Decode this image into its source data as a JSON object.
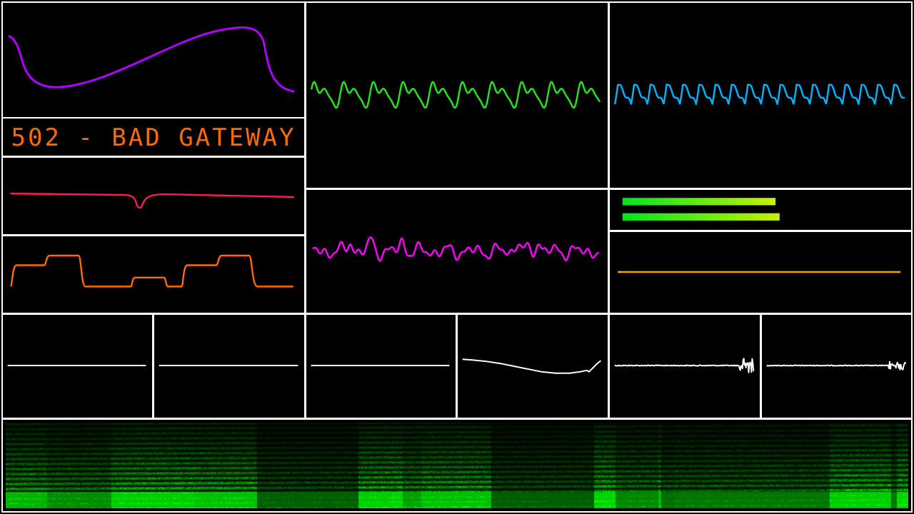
{
  "status": {
    "text": "502 - BAD GATEWAY",
    "color": "#ff6a00"
  },
  "colors": {
    "background": "#000000",
    "border": "#ffffff",
    "envelope_trace": "#b000ff",
    "dip_trace": "#ff1a5c",
    "step_trace": "#ff6a00",
    "green_wave": "#22e51a",
    "blue_wave": "#00b2ff",
    "magenta_wave": "#ff00ff",
    "flat_trace": "#ffa000",
    "scope_trace": "#ffffff",
    "level_bar_start": "#00e61e",
    "level_bar_end": "#c8f000",
    "spectrogram": "#00ff00"
  },
  "level_meters": [
    {
      "name": "level-left",
      "level": 0.56
    },
    {
      "name": "level-right",
      "level": 0.575
    }
  ]
}
